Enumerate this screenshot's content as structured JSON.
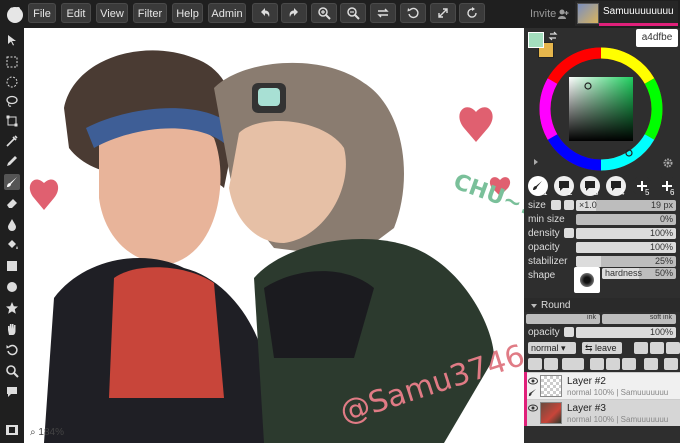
{
  "menu": [
    "File",
    "Edit",
    "View",
    "Filter",
    "Help",
    "Admin"
  ],
  "topbar": {
    "invite": "Invite",
    "username": "Samuuuuuuuuu"
  },
  "canvas": {
    "zoom": "184%",
    "watermark": "@Samu3746",
    "text_chu": "CHU~!"
  },
  "colors": {
    "hex": "a4dfbe",
    "foreground": "#a4dfbe",
    "background": "#e6b64c",
    "accent": "#e0207a"
  },
  "brush_slots": [
    "1",
    "2",
    "3",
    "4",
    "5",
    "6"
  ],
  "properties": {
    "size": {
      "label": "size",
      "mult": "×1.0",
      "value": "19 px",
      "fill": 0.2
    },
    "min_size": {
      "label": "min size",
      "value": "0%",
      "fill": 0.0
    },
    "density": {
      "label": "density",
      "value": "100%",
      "fill": 1.0
    },
    "opacity": {
      "label": "opacity",
      "value": "100%",
      "fill": 1.0
    },
    "stabilizer": {
      "label": "stabilizer",
      "value": "25%",
      "fill": 0.25
    },
    "shape": {
      "label": "shape",
      "hardness_label": "hardness",
      "hardness": "50%",
      "fill": 0.5
    }
  },
  "brush_preset": "Round",
  "brush_strip": [
    "ink",
    "soft ink"
  ],
  "layer_opacity": {
    "label": "opacity",
    "value": "100%"
  },
  "blend": {
    "mode": "normal",
    "leave": "leave"
  },
  "layers": [
    {
      "name": "Layer #2",
      "info": "normal 100% | Samuuuuuuu",
      "selected": false
    },
    {
      "name": "Layer #3",
      "info": "normal 100% | Samuuuuuuu",
      "selected": true
    }
  ]
}
